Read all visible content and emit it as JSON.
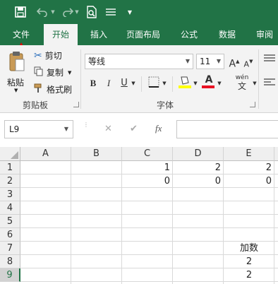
{
  "qat": {
    "save_icon": "save-icon",
    "undo_icon": "undo-icon",
    "redo_icon": "redo-icon",
    "preview_icon": "print-preview-icon",
    "format_icon": "list-icon",
    "customize_icon": "chevron-down-icon"
  },
  "tabs": [
    {
      "label": "文件"
    },
    {
      "label": "开始"
    },
    {
      "label": "插入"
    },
    {
      "label": "页面布局"
    },
    {
      "label": "公式"
    },
    {
      "label": "数据"
    },
    {
      "label": "审阅"
    }
  ],
  "clipboard": {
    "paste_label": "粘贴",
    "cut_label": "剪切",
    "copy_label": "复制",
    "format_painter_label": "格式刷",
    "group_label": "剪贴板"
  },
  "font": {
    "family": "等线",
    "size": "11",
    "bold": "B",
    "italic": "I",
    "underline": "U",
    "group_label": "字体",
    "wen": "wén",
    "wen_char": "文",
    "grow_glyph": "A",
    "shrink_glyph": "A"
  },
  "formula_bar": {
    "name_box": "L9",
    "cancel": "✕",
    "enter": "✔",
    "fx": "fx",
    "content": ""
  },
  "columns": [
    "A",
    "B",
    "C",
    "D",
    "E"
  ],
  "rows": [
    "1",
    "2",
    "3",
    "4",
    "5",
    "6",
    "7",
    "8",
    "9"
  ],
  "cells": {
    "C1": "1",
    "D1": "2",
    "E1": "2",
    "C2": "0",
    "D2": "0",
    "E2": "0",
    "E7": "加数",
    "E8": "2",
    "E9": "2"
  },
  "selected_row": "9",
  "colors": {
    "accent": "#217346",
    "font_color_bar": "#e81123",
    "highlight_bar": "#ffff00"
  }
}
